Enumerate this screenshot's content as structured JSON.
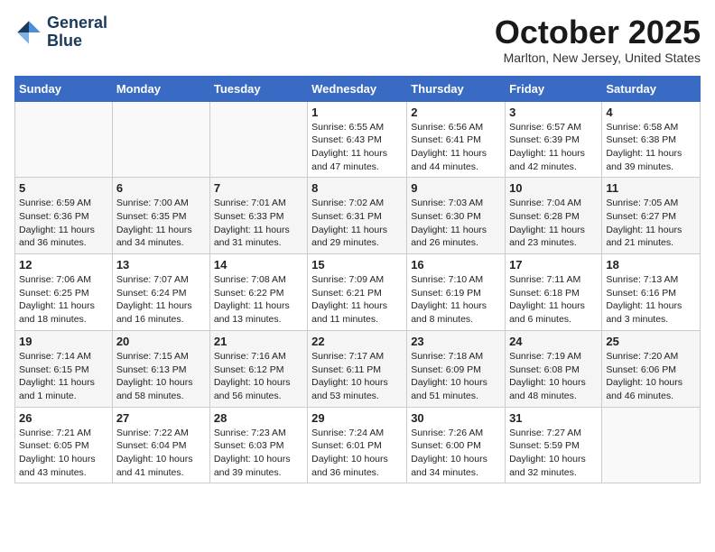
{
  "header": {
    "logo_line1": "General",
    "logo_line2": "Blue",
    "month": "October 2025",
    "location": "Marlton, New Jersey, United States"
  },
  "weekdays": [
    "Sunday",
    "Monday",
    "Tuesday",
    "Wednesday",
    "Thursday",
    "Friday",
    "Saturday"
  ],
  "weeks": [
    [
      {
        "day": "",
        "info": ""
      },
      {
        "day": "",
        "info": ""
      },
      {
        "day": "",
        "info": ""
      },
      {
        "day": "1",
        "info": "Sunrise: 6:55 AM\nSunset: 6:43 PM\nDaylight: 11 hours\nand 47 minutes."
      },
      {
        "day": "2",
        "info": "Sunrise: 6:56 AM\nSunset: 6:41 PM\nDaylight: 11 hours\nand 44 minutes."
      },
      {
        "day": "3",
        "info": "Sunrise: 6:57 AM\nSunset: 6:39 PM\nDaylight: 11 hours\nand 42 minutes."
      },
      {
        "day": "4",
        "info": "Sunrise: 6:58 AM\nSunset: 6:38 PM\nDaylight: 11 hours\nand 39 minutes."
      }
    ],
    [
      {
        "day": "5",
        "info": "Sunrise: 6:59 AM\nSunset: 6:36 PM\nDaylight: 11 hours\nand 36 minutes."
      },
      {
        "day": "6",
        "info": "Sunrise: 7:00 AM\nSunset: 6:35 PM\nDaylight: 11 hours\nand 34 minutes."
      },
      {
        "day": "7",
        "info": "Sunrise: 7:01 AM\nSunset: 6:33 PM\nDaylight: 11 hours\nand 31 minutes."
      },
      {
        "day": "8",
        "info": "Sunrise: 7:02 AM\nSunset: 6:31 PM\nDaylight: 11 hours\nand 29 minutes."
      },
      {
        "day": "9",
        "info": "Sunrise: 7:03 AM\nSunset: 6:30 PM\nDaylight: 11 hours\nand 26 minutes."
      },
      {
        "day": "10",
        "info": "Sunrise: 7:04 AM\nSunset: 6:28 PM\nDaylight: 11 hours\nand 23 minutes."
      },
      {
        "day": "11",
        "info": "Sunrise: 7:05 AM\nSunset: 6:27 PM\nDaylight: 11 hours\nand 21 minutes."
      }
    ],
    [
      {
        "day": "12",
        "info": "Sunrise: 7:06 AM\nSunset: 6:25 PM\nDaylight: 11 hours\nand 18 minutes."
      },
      {
        "day": "13",
        "info": "Sunrise: 7:07 AM\nSunset: 6:24 PM\nDaylight: 11 hours\nand 16 minutes."
      },
      {
        "day": "14",
        "info": "Sunrise: 7:08 AM\nSunset: 6:22 PM\nDaylight: 11 hours\nand 13 minutes."
      },
      {
        "day": "15",
        "info": "Sunrise: 7:09 AM\nSunset: 6:21 PM\nDaylight: 11 hours\nand 11 minutes."
      },
      {
        "day": "16",
        "info": "Sunrise: 7:10 AM\nSunset: 6:19 PM\nDaylight: 11 hours\nand 8 minutes."
      },
      {
        "day": "17",
        "info": "Sunrise: 7:11 AM\nSunset: 6:18 PM\nDaylight: 11 hours\nand 6 minutes."
      },
      {
        "day": "18",
        "info": "Sunrise: 7:13 AM\nSunset: 6:16 PM\nDaylight: 11 hours\nand 3 minutes."
      }
    ],
    [
      {
        "day": "19",
        "info": "Sunrise: 7:14 AM\nSunset: 6:15 PM\nDaylight: 11 hours\nand 1 minute."
      },
      {
        "day": "20",
        "info": "Sunrise: 7:15 AM\nSunset: 6:13 PM\nDaylight: 10 hours\nand 58 minutes."
      },
      {
        "day": "21",
        "info": "Sunrise: 7:16 AM\nSunset: 6:12 PM\nDaylight: 10 hours\nand 56 minutes."
      },
      {
        "day": "22",
        "info": "Sunrise: 7:17 AM\nSunset: 6:11 PM\nDaylight: 10 hours\nand 53 minutes."
      },
      {
        "day": "23",
        "info": "Sunrise: 7:18 AM\nSunset: 6:09 PM\nDaylight: 10 hours\nand 51 minutes."
      },
      {
        "day": "24",
        "info": "Sunrise: 7:19 AM\nSunset: 6:08 PM\nDaylight: 10 hours\nand 48 minutes."
      },
      {
        "day": "25",
        "info": "Sunrise: 7:20 AM\nSunset: 6:06 PM\nDaylight: 10 hours\nand 46 minutes."
      }
    ],
    [
      {
        "day": "26",
        "info": "Sunrise: 7:21 AM\nSunset: 6:05 PM\nDaylight: 10 hours\nand 43 minutes."
      },
      {
        "day": "27",
        "info": "Sunrise: 7:22 AM\nSunset: 6:04 PM\nDaylight: 10 hours\nand 41 minutes."
      },
      {
        "day": "28",
        "info": "Sunrise: 7:23 AM\nSunset: 6:03 PM\nDaylight: 10 hours\nand 39 minutes."
      },
      {
        "day": "29",
        "info": "Sunrise: 7:24 AM\nSunset: 6:01 PM\nDaylight: 10 hours\nand 36 minutes."
      },
      {
        "day": "30",
        "info": "Sunrise: 7:26 AM\nSunset: 6:00 PM\nDaylight: 10 hours\nand 34 minutes."
      },
      {
        "day": "31",
        "info": "Sunrise: 7:27 AM\nSunset: 5:59 PM\nDaylight: 10 hours\nand 32 minutes."
      },
      {
        "day": "",
        "info": ""
      }
    ]
  ]
}
